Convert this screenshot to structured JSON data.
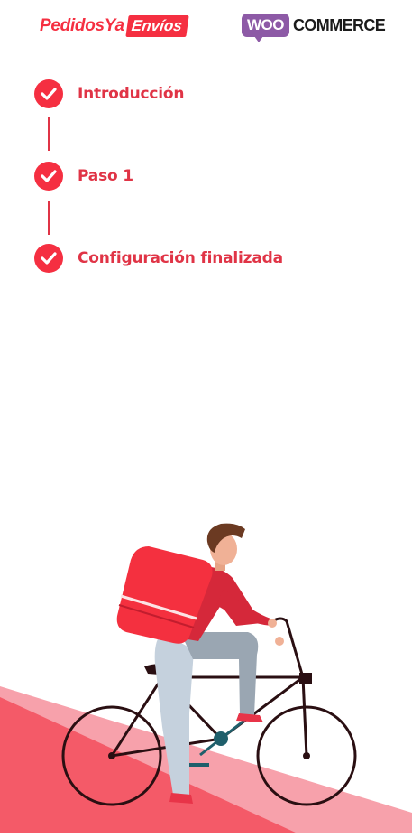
{
  "header": {
    "pedidosya_brand": "PedidosYa",
    "pedidosya_badge": "Envíos",
    "woo_bubble": "WOO",
    "woo_word": "COMMERCE"
  },
  "steps": [
    {
      "label": "Introducción",
      "status": "completed"
    },
    {
      "label": "Paso 1",
      "status": "completed"
    },
    {
      "label": "Configuración finalizada",
      "status": "completed"
    }
  ],
  "colors": {
    "accent": "#f52f41",
    "woo_purple": "#8d5aa6"
  },
  "icons": [
    "check-icon",
    "delivery-cyclist-illustration"
  ]
}
